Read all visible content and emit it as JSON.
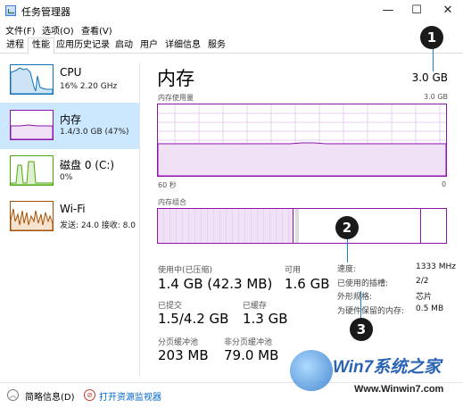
{
  "window": {
    "title": "任务管理器",
    "minimize": "—",
    "maximize": "☐",
    "close": "✕"
  },
  "menu": [
    "文件(F)",
    "选项(O)",
    "查看(V)"
  ],
  "tabs": [
    "进程",
    "性能",
    "应用历史记录",
    "启动",
    "用户",
    "详细信息",
    "服务"
  ],
  "active_tab": "性能",
  "sidebar": [
    {
      "name": "CPU",
      "sub": "16% 2.20 GHz",
      "color": "#1170b8"
    },
    {
      "name": "内存",
      "sub": "1.4/3.0 GB (47%)",
      "color": "#8b12ae"
    },
    {
      "name": "磁盘 0 (C:)",
      "sub": "0%",
      "color": "#4da60c"
    },
    {
      "name": "Wi-Fi",
      "sub": "发送: 24.0  接收: 8.0",
      "color": "#a74f01"
    }
  ],
  "memory": {
    "title": "内存",
    "total": "3.0 GB",
    "usage_label": "内存使用量",
    "usage_max": "3.0 GB",
    "time_label": "60 秒",
    "time_end": "0",
    "composition_label": "内存组合",
    "in_use_fraction": 0.47,
    "usage_history_fraction": 0.45
  },
  "stats": {
    "in_use_label": "使用中(已压缩)",
    "in_use_value": "1.4 GB (42.3 MB)",
    "available_label": "可用",
    "available_value": "1.6 GB",
    "committed_label": "已提交",
    "committed_value": "1.5/4.2 GB",
    "cached_label": "已缓存",
    "cached_value": "1.3 GB",
    "paged_label": "分页缓冲池",
    "paged_value": "203 MB",
    "nonpaged_label": "非分页缓冲池",
    "nonpaged_value": "79.0 MB"
  },
  "details": [
    {
      "label": "速度:",
      "value": "1333 MHz"
    },
    {
      "label": "已使用的插槽:",
      "value": "2/2"
    },
    {
      "label": "外形规格:",
      "value": "芯片"
    },
    {
      "label": "为硬件保留的内存:",
      "value": "0.5 MB"
    }
  ],
  "footer": {
    "summary": "简略信息(D)",
    "monitor": "打开资源监视器"
  },
  "callouts": [
    "1",
    "2",
    "3"
  ],
  "watermark": {
    "brand": "Win7系统之家",
    "url": "Www.Winwin7.com"
  }
}
